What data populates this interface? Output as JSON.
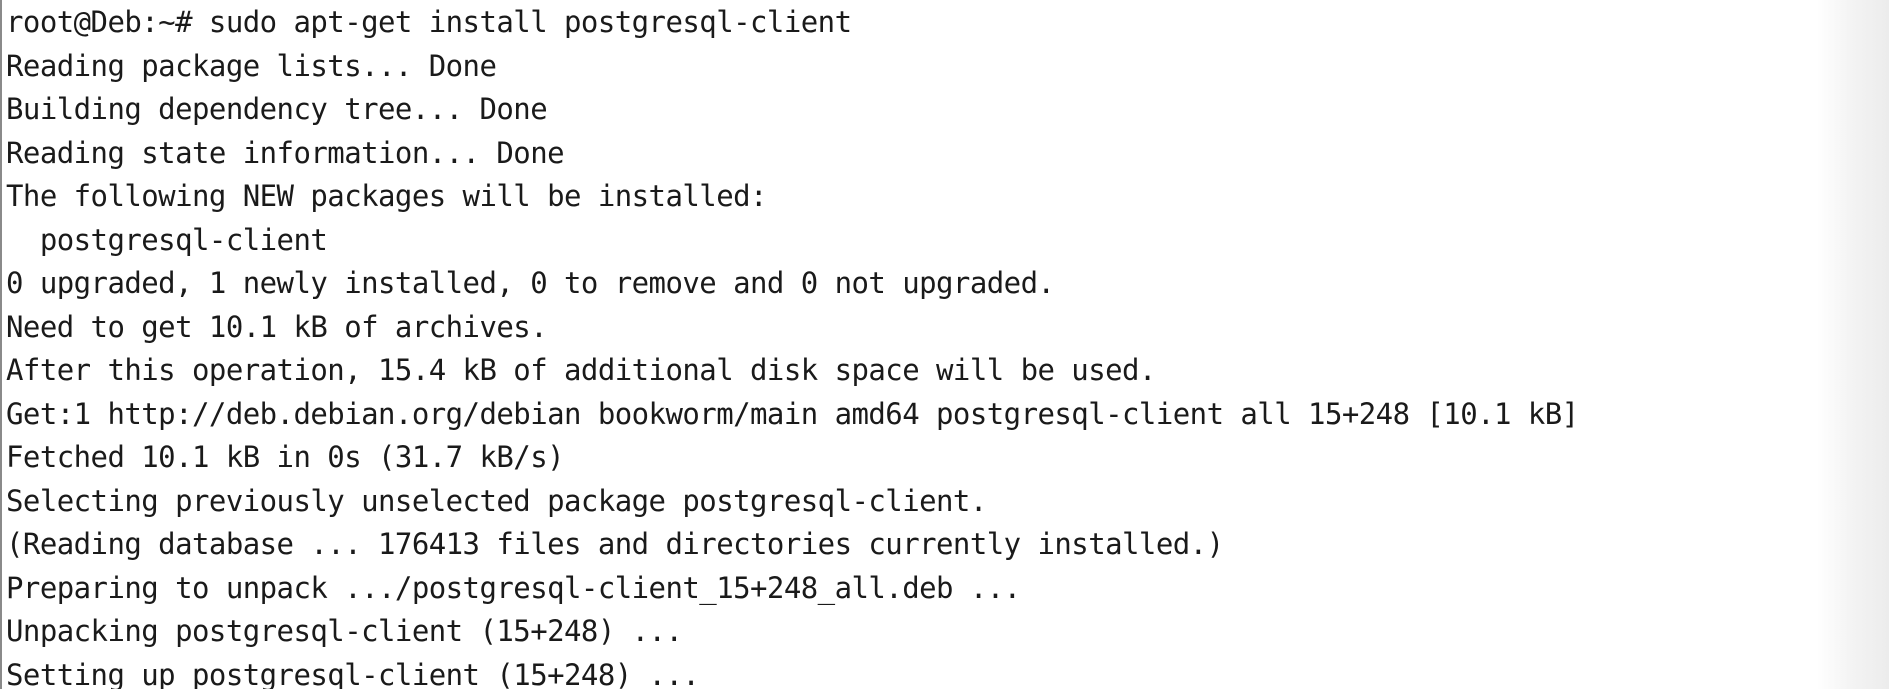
{
  "terminal": {
    "lines": [
      "root@Deb:~# sudo apt-get install postgresql-client",
      "Reading package lists... Done",
      "Building dependency tree... Done",
      "Reading state information... Done",
      "The following NEW packages will be installed:",
      "  postgresql-client",
      "0 upgraded, 1 newly installed, 0 to remove and 0 not upgraded.",
      "Need to get 10.1 kB of archives.",
      "After this operation, 15.4 kB of additional disk space will be used.",
      "Get:1 http://deb.debian.org/debian bookworm/main amd64 postgresql-client all 15+248 [10.1 kB]",
      "Fetched 10.1 kB in 0s (31.7 kB/s)",
      "Selecting previously unselected package postgresql-client.",
      "(Reading database ... 176413 files and directories currently installed.)",
      "Preparing to unpack .../postgresql-client_15+248_all.deb ...",
      "Unpacking postgresql-client (15+248) ...",
      "Setting up postgresql-client (15+248) ..."
    ],
    "colors": {
      "background": "#ffffff",
      "foreground": "#1a1a1a"
    }
  }
}
